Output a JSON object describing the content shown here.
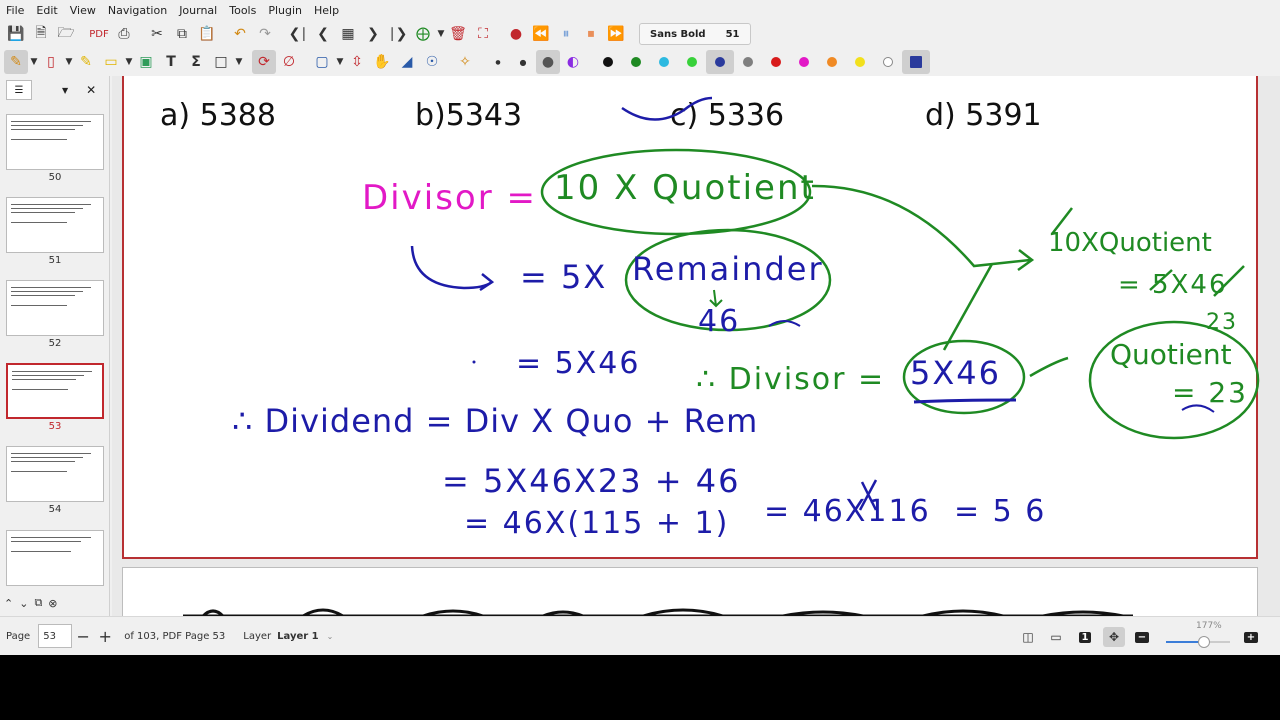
{
  "menu": [
    "File",
    "Edit",
    "View",
    "Navigation",
    "Journal",
    "Tools",
    "Plugin",
    "Help"
  ],
  "font": {
    "name": "Sans Bold",
    "size": "51"
  },
  "colors": {
    "accent": "#c1272d",
    "palette": [
      "#111111",
      "#1f8a23",
      "#2db9e0",
      "#38d13a",
      "#2a3a9c",
      "#7f7f7f",
      "#d81b1b",
      "#e219c6",
      "#f08a24",
      "#f2e01c",
      "#ffffff"
    ],
    "selected_palette": "#2a3a9c",
    "ink_pink": "#e219c6",
    "ink_blue": "#1d1ca8",
    "ink_green": "#1f8a23"
  },
  "sidebar": {
    "pages": [
      {
        "num": "50"
      },
      {
        "num": "51"
      },
      {
        "num": "52"
      },
      {
        "num": "53",
        "selected": true
      },
      {
        "num": "54"
      }
    ]
  },
  "page": {
    "options": [
      "a) 5388",
      "b)5343",
      "c) 5336",
      "d) 5391"
    ],
    "handwriting": {
      "divisor": "Divisor =",
      "ten_quotient": "10 X Quotient",
      "eq_5x": "= 5X",
      "remainder": "Remainder",
      "r_46": "46",
      "eq_5x46": "= 5X46",
      "therefore_divisor": "∴ Divisor =",
      "five_x_46": "5X46",
      "side_10x": "10XQuotient",
      "side_5x46": "= 5X46",
      "side_23": "23",
      "quotient": "Quotient",
      "eq_23": "= 23",
      "dividend": "∴ Dividend = Div X Quo + Rem",
      "line2": "= 5X46X23 + 46",
      "line3": "= 46X(115 + 1)",
      "line4": "= 46X116",
      "line5": "= 5   6"
    }
  },
  "statusbar": {
    "page_label": "Page",
    "page_value": "53",
    "of_pages": "of 103, PDF Page 53",
    "layer_label": "Layer",
    "layer_value": "Layer 1",
    "zoom": "177%",
    "zoom_fraction": 0.6
  }
}
